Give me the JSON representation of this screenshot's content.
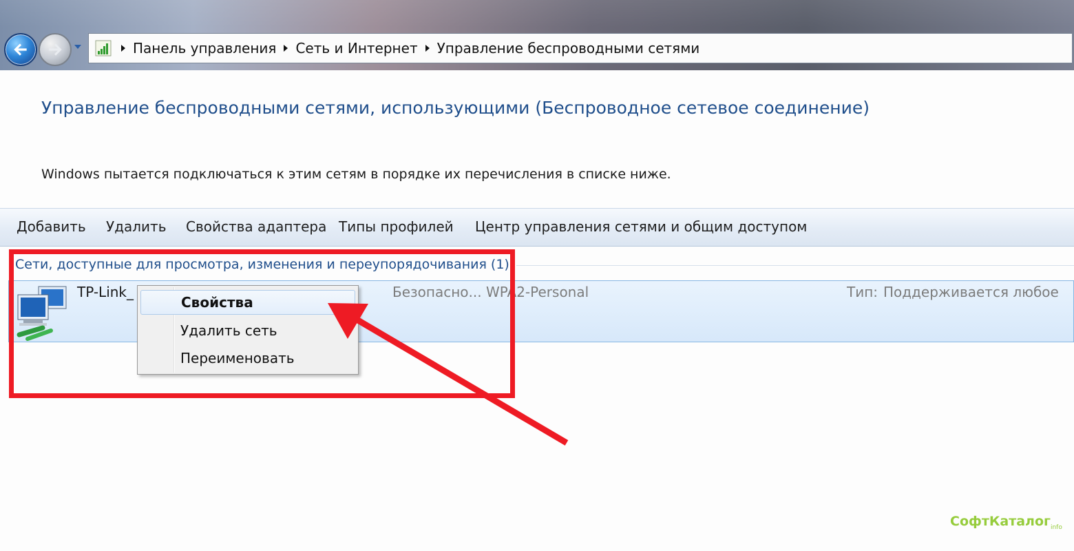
{
  "nav": {
    "breadcrumb": [
      "Панель управления",
      "Сеть и Интернет",
      "Управление беспроводными сетями"
    ]
  },
  "main": {
    "heading": "Управление беспроводными сетями, использующими (Беспроводное сетевое соединение)",
    "description": "Windows пытается подключаться к этим сетям в порядке их перечисления в списке ниже."
  },
  "toolbar": {
    "items": [
      "Добавить",
      "Удалить",
      "Свойства адаптера",
      "Типы профилей",
      "Центр управления сетями и общим доступом"
    ]
  },
  "networks": {
    "group_header": "Сети, доступные для просмотра, изменения и переупорядочивания (1)",
    "rows": [
      {
        "name": "TP-Link_",
        "security": "Безопасно...  WPA2-Personal",
        "type_label": "Тип:",
        "type_value": "Поддерживается любое"
      }
    ]
  },
  "context_menu": {
    "items": [
      "Свойства",
      "Удалить сеть",
      "Переименовать"
    ],
    "highlighted_index": 0
  },
  "annotation": {
    "color": "#ee1b24"
  },
  "watermark": {
    "text": "СофтКаталог",
    "suffix": "info",
    "color": "#96cc3c"
  },
  "colors": {
    "heading": "#1f4e8b",
    "row_selected": "#d7e8fa"
  }
}
